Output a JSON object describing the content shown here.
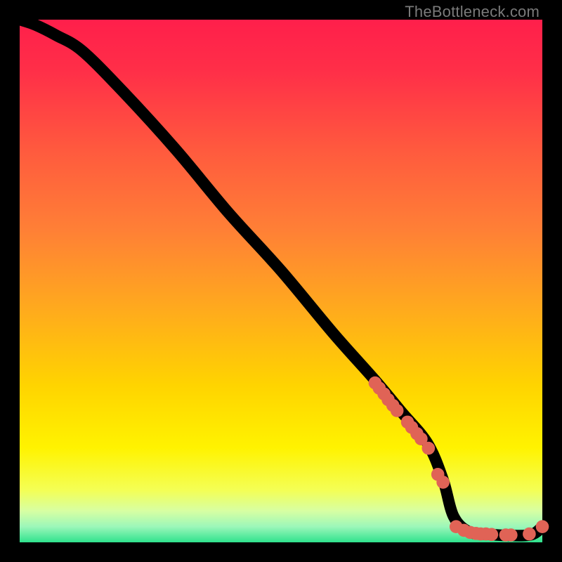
{
  "watermark": "TheBottleneck.com",
  "colors": {
    "marker": "#e06356",
    "line": "#000000",
    "frame": "#000000"
  },
  "chart_data": {
    "type": "line",
    "title": "",
    "xlabel": "",
    "ylabel": "",
    "xlim": [
      0,
      100
    ],
    "ylim": [
      0,
      100
    ],
    "grid": false,
    "legend": false,
    "note": "Axes are unlabeled in the source; x/y are 0–100 image-normalized. Curve starts near top-left, descends roughly linearly, flattens near y≈2 around x≈83, then stays near baseline.",
    "series": [
      {
        "name": "curve",
        "kind": "line",
        "x": [
          0,
          3,
          7,
          12,
          20,
          30,
          40,
          50,
          60,
          68,
          73,
          78,
          81,
          83,
          86,
          90,
          94,
          98,
          100
        ],
        "y": [
          100,
          99,
          97,
          94,
          86,
          75,
          63,
          52,
          40,
          31,
          25,
          19,
          12,
          5,
          2,
          1.5,
          1.3,
          1.5,
          3
        ]
      },
      {
        "name": "upper-cluster",
        "kind": "scatter",
        "x": [
          68.0,
          68.8,
          69.7,
          70.5,
          71.4,
          72.2,
          74.2,
          75.0,
          76.0,
          76.8,
          78.2,
          80.0,
          81.0
        ],
        "y": [
          30.5,
          29.5,
          28.4,
          27.3,
          26.2,
          25.2,
          23.0,
          22.0,
          20.8,
          19.8,
          18.0,
          13.0,
          11.5
        ]
      },
      {
        "name": "baseline-cluster",
        "kind": "scatter",
        "x": [
          83.5,
          85.0,
          86.2,
          87.3,
          88.2,
          89.2,
          90.3,
          93.0,
          94.0,
          97.5,
          100.0
        ],
        "y": [
          3.0,
          2.3,
          1.9,
          1.7,
          1.6,
          1.6,
          1.5,
          1.4,
          1.4,
          1.6,
          3.0
        ]
      }
    ],
    "gradient_stops": [
      {
        "offset": 0.0,
        "color": "#ff1f4b"
      },
      {
        "offset": 0.1,
        "color": "#ff2f48"
      },
      {
        "offset": 0.25,
        "color": "#ff5a3e"
      },
      {
        "offset": 0.4,
        "color": "#ff7f36"
      },
      {
        "offset": 0.55,
        "color": "#ffa91e"
      },
      {
        "offset": 0.7,
        "color": "#ffd400"
      },
      {
        "offset": 0.82,
        "color": "#fff300"
      },
      {
        "offset": 0.9,
        "color": "#f4ff55"
      },
      {
        "offset": 0.94,
        "color": "#d7ffa3"
      },
      {
        "offset": 0.97,
        "color": "#9cf7b9"
      },
      {
        "offset": 1.0,
        "color": "#2fe28d"
      }
    ]
  }
}
